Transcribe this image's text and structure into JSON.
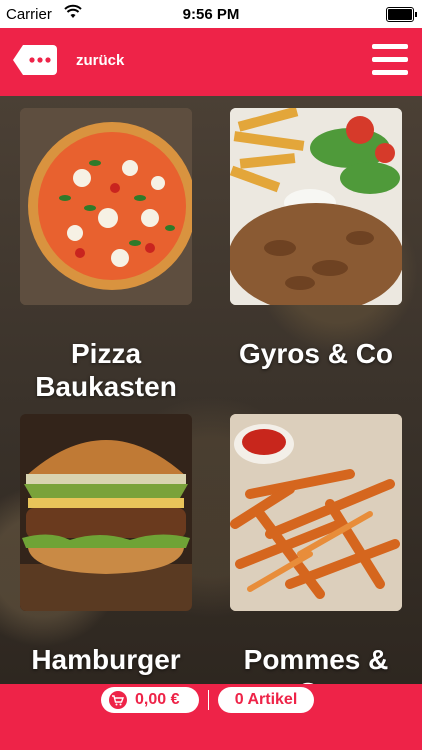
{
  "status": {
    "carrier": "Carrier",
    "time": "9:56 PM"
  },
  "header": {
    "back_label": "zurück"
  },
  "categories": [
    {
      "label": "Pizza Baukasten"
    },
    {
      "label": "Gyros & Co"
    },
    {
      "label": "Hamburger"
    },
    {
      "label": "Pommes & Co"
    }
  ],
  "footer": {
    "price": "0,00 €",
    "items": "0 Artikel"
  },
  "colors": {
    "accent": "#ee2348"
  },
  "icons": [
    "wifi-icon",
    "battery-icon",
    "chat-back-icon",
    "hamburger-menu-icon",
    "cart-icon"
  ]
}
